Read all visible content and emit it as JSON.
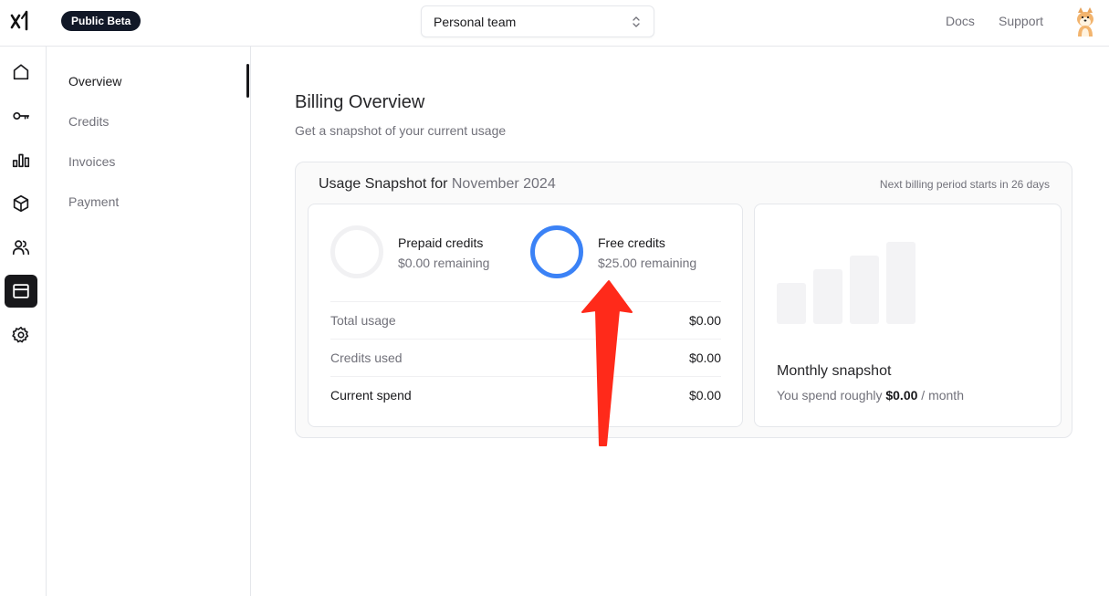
{
  "header": {
    "badge": "Public Beta",
    "team_select": "Personal team",
    "links": {
      "docs": "Docs",
      "support": "Support"
    }
  },
  "rail": {
    "items": [
      {
        "icon": "home-icon"
      },
      {
        "icon": "key-icon"
      },
      {
        "icon": "bar-chart-icon"
      },
      {
        "icon": "cube-icon"
      },
      {
        "icon": "users-icon"
      },
      {
        "icon": "billing-icon",
        "active": true
      },
      {
        "icon": "gear-icon"
      }
    ]
  },
  "subnav": {
    "items": [
      "Overview",
      "Credits",
      "Invoices",
      "Payment"
    ],
    "active": "Overview"
  },
  "main": {
    "title": "Billing Overview",
    "subtitle": "Get a snapshot of your current usage",
    "snapshot": {
      "title_prefix": "Usage Snapshot for",
      "month": "November 2024",
      "next_billing": "Next billing period starts in 26 days",
      "prepaid": {
        "name": "Prepaid credits",
        "remaining": "$0.00 remaining"
      },
      "free": {
        "name": "Free credits",
        "remaining": "$25.00 remaining"
      },
      "rows": [
        {
          "label": "Total usage",
          "value": "$0.00"
        },
        {
          "label": "Credits used",
          "value": "$0.00"
        },
        {
          "label": "Current spend",
          "value": "$0.00"
        }
      ],
      "monthly": {
        "title": "Monthly snapshot",
        "prefix": "You spend roughly",
        "amount": "$0.00",
        "suffix": "/ month"
      }
    }
  },
  "colors": {
    "accent": "#3b82f6",
    "annotation": "#ff2a1a",
    "dark": "#18181b"
  }
}
